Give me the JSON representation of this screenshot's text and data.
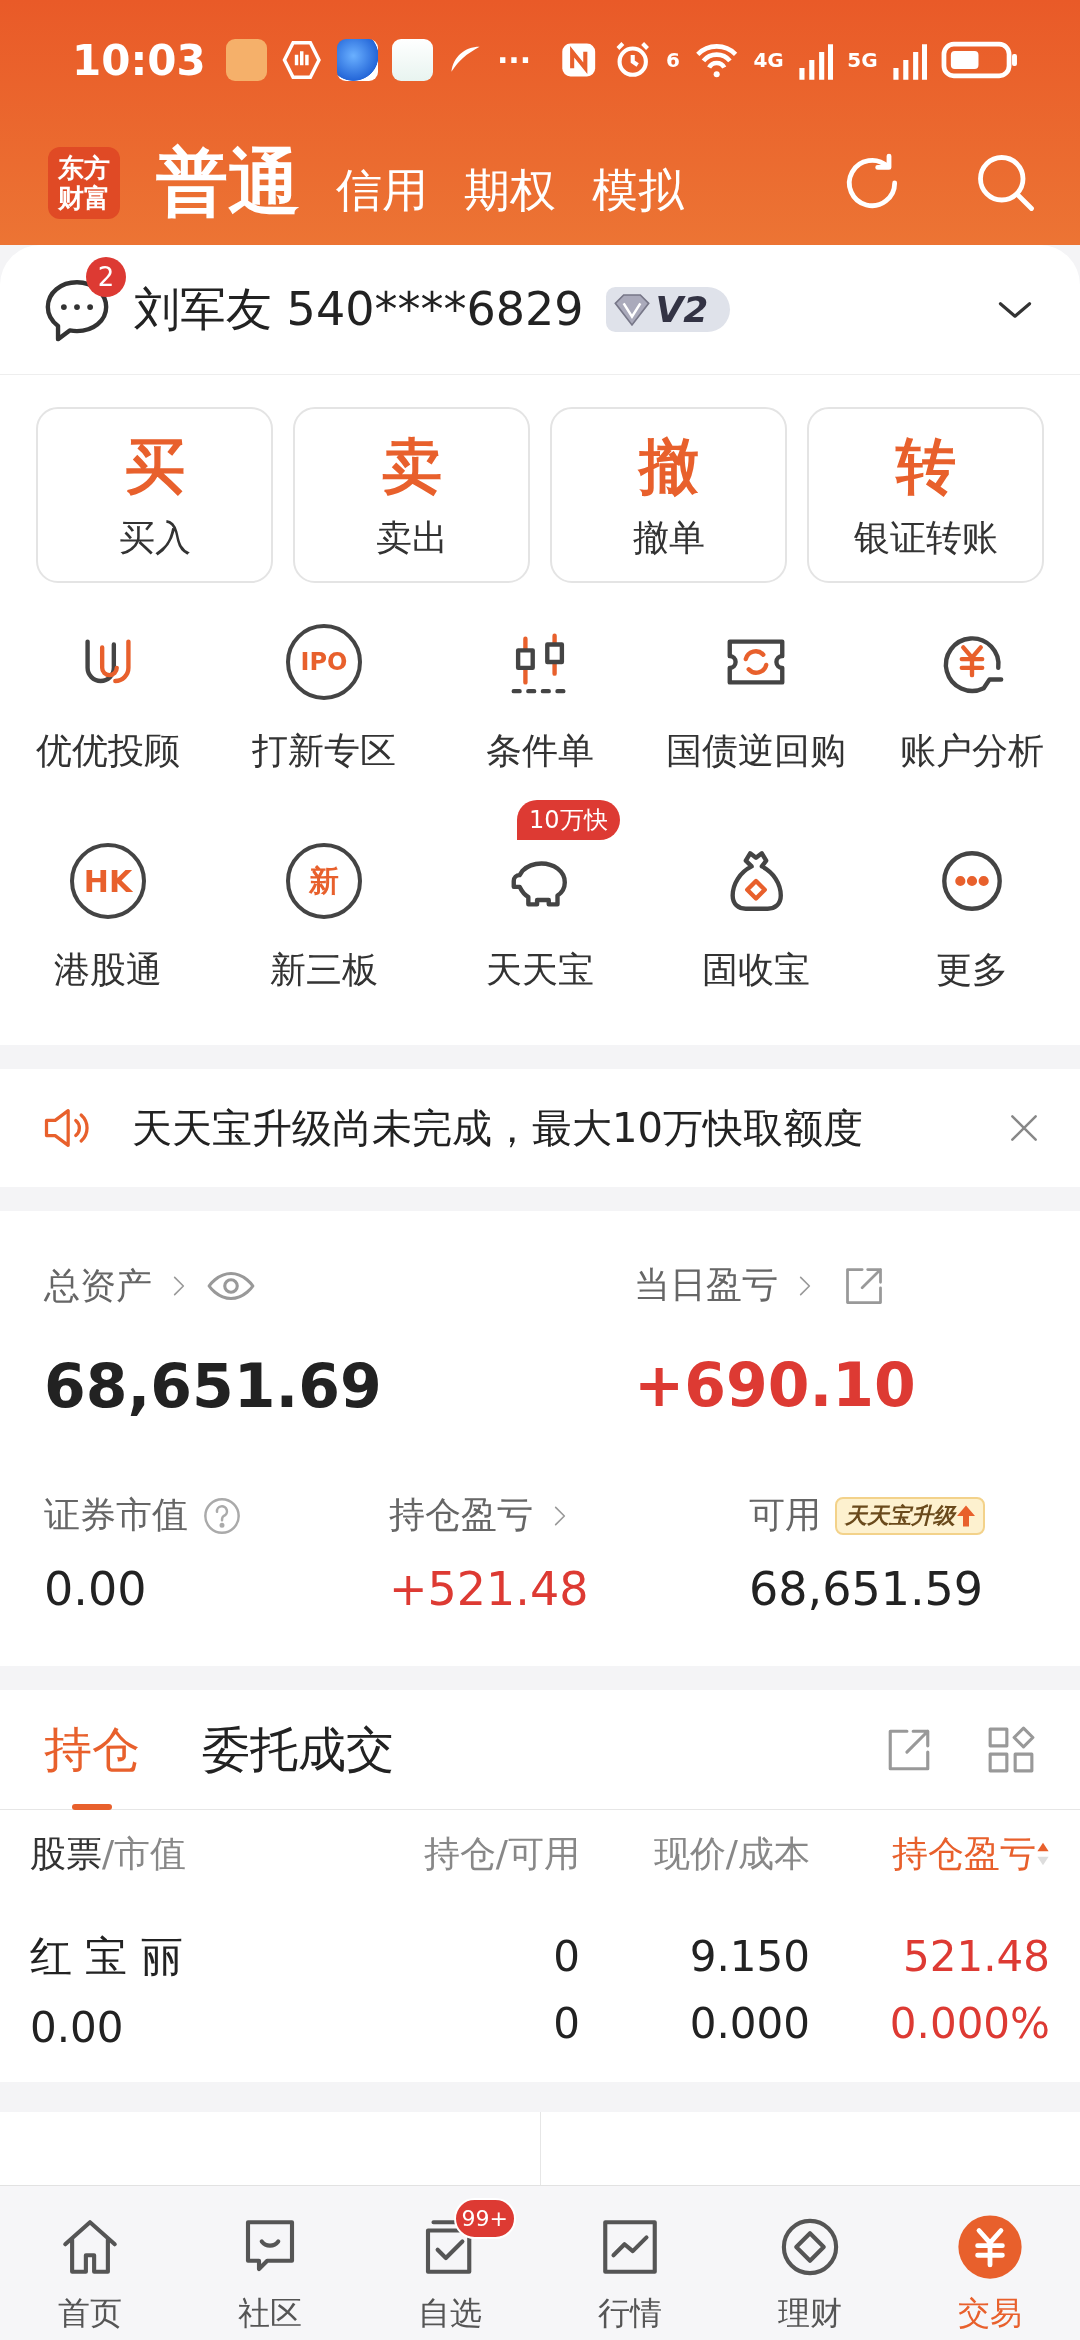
{
  "status_bar": {
    "time": "10:03",
    "more": "···",
    "wifi_band": "6",
    "cell_1": "4G",
    "cell_2": "5G"
  },
  "header": {
    "logo_lines": [
      "东方",
      "财富"
    ],
    "tabs": [
      {
        "label": "普通",
        "selected": true
      },
      {
        "label": "信用",
        "selected": false
      },
      {
        "label": "期权",
        "selected": false
      },
      {
        "label": "模拟",
        "selected": false
      }
    ]
  },
  "account": {
    "unread": "2",
    "name": "刘军友 540****6829",
    "level": "V2"
  },
  "trade_buttons": [
    {
      "glyph": "买",
      "label": "买入"
    },
    {
      "glyph": "卖",
      "label": "卖出"
    },
    {
      "glyph": "撤",
      "label": "撤单"
    },
    {
      "glyph": "转",
      "label": "银证转账"
    }
  ],
  "tools": [
    {
      "label": "优优投顾"
    },
    {
      "label": "打新专区",
      "icon_text": "IPO"
    },
    {
      "label": "条件单"
    },
    {
      "label": "国债逆回购"
    },
    {
      "label": "账户分析"
    },
    {
      "label": "港股通",
      "icon_text": "HK"
    },
    {
      "label": "新三板",
      "icon_text": "新"
    },
    {
      "label": "天天宝",
      "badge": "10万快"
    },
    {
      "label": "固收宝"
    },
    {
      "label": "更多"
    }
  ],
  "notice": {
    "text": "天天宝升级尚未完成，最大10万快取额度"
  },
  "assets": {
    "total_label": "总资产",
    "total": "68,651.69",
    "day_label": "当日盈亏",
    "day": "+690.10",
    "items": [
      {
        "label": "证券市值",
        "value": "0.00",
        "kind": "help"
      },
      {
        "label": "持仓盈亏",
        "value": "+521.48",
        "kind": "link"
      },
      {
        "label": "可用",
        "value": "68,651.59",
        "kind": "tag",
        "tag": "天天宝升级"
      }
    ]
  },
  "positions": {
    "tabs": [
      {
        "label": "持仓",
        "selected": true
      },
      {
        "label": "委托成交",
        "selected": false
      }
    ],
    "columns": [
      {
        "label": "股票",
        "sub": "/市值",
        "sorted": false
      },
      {
        "label": "持仓/可用",
        "sorted": false
      },
      {
        "label": "现价/成本",
        "sorted": false
      },
      {
        "label": "持仓盈亏",
        "sorted": true
      }
    ],
    "rows": [
      {
        "name": "红 宝 丽",
        "market_value": "0.00",
        "holding": "0",
        "available": "0",
        "price": "9.150",
        "cost": "0.000",
        "pnl": "521.48",
        "pnl_pct": "0.000%"
      }
    ]
  },
  "bottom_nav": [
    {
      "label": "首页",
      "selected": false
    },
    {
      "label": "社区",
      "selected": false
    },
    {
      "label": "自选",
      "selected": false,
      "badge": "99+"
    },
    {
      "label": "行情",
      "selected": false
    },
    {
      "label": "理财",
      "selected": false
    },
    {
      "label": "交易",
      "selected": true
    }
  ]
}
